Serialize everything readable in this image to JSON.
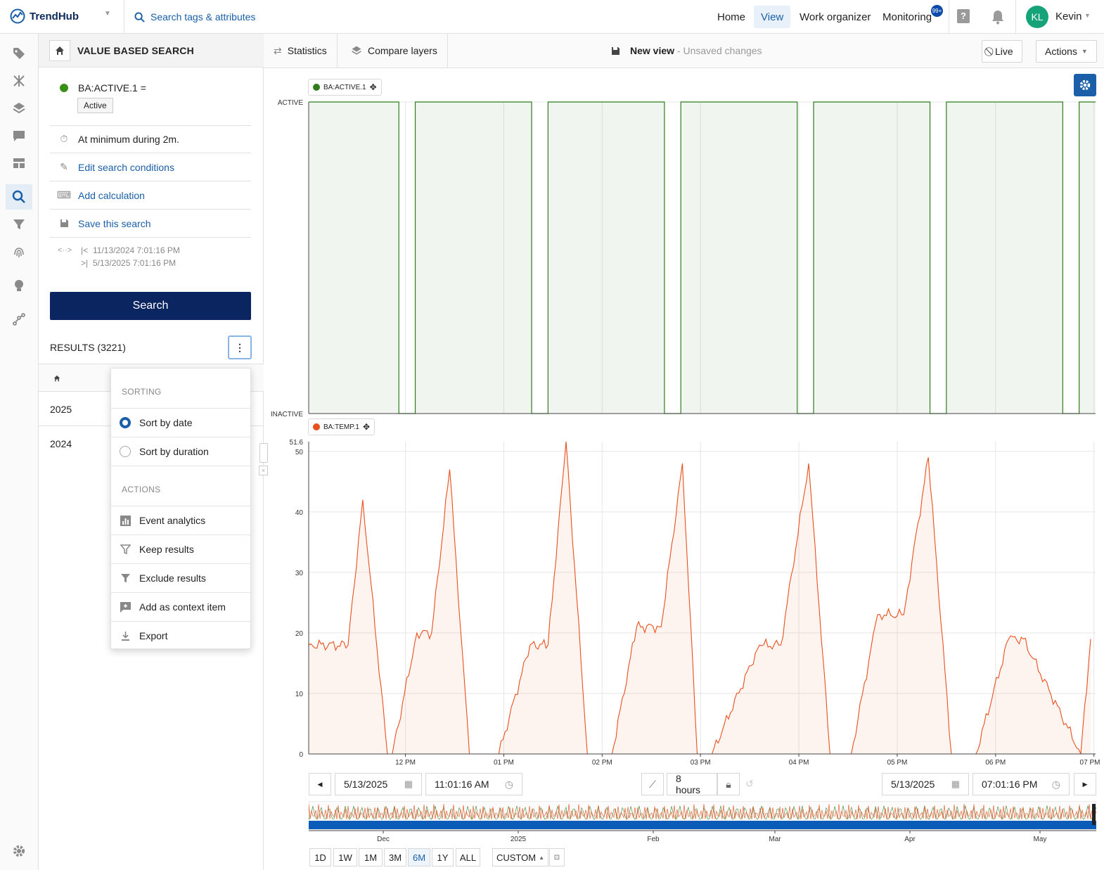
{
  "header": {
    "app_name": "TrendHub",
    "search_placeholder": "Search tags & attributes",
    "nav": [
      "Home",
      "View",
      "Work organizer",
      "Monitoring"
    ],
    "active_nav": "View",
    "monitoring_badge": "99+",
    "user_initials": "KL",
    "user_name": "Kevin"
  },
  "sidebar_icons": [
    "tag-icon",
    "network-icon",
    "layers-icon",
    "comment-icon",
    "dashboard-icon",
    "search-icon",
    "filter-icon",
    "fingerprint-icon",
    "lightbulb-icon",
    "graph-icon",
    "gear-icon"
  ],
  "panel": {
    "title": "VALUE BASED SEARCH",
    "tag": "BA:ACTIVE.1 =",
    "tag_value": "Active",
    "condition": "At minimum during 2m.",
    "edit_label": "Edit search conditions",
    "calc_label": "Add calculation",
    "save_label": "Save this search",
    "range_start": "11/13/2024 7:01:16 PM",
    "range_end": "5/13/2025 7:01:16 PM",
    "search_button": "Search",
    "results_label": "RESULTS (3221)",
    "years": [
      "2025",
      "2024"
    ]
  },
  "menu": {
    "sorting_label": "SORTING",
    "sort_by_date": "Sort by date",
    "sort_by_duration": "Sort by duration",
    "actions_label": "ACTIONS",
    "event_analytics": "Event analytics",
    "keep_results": "Keep results",
    "exclude_results": "Exclude results",
    "add_context": "Add as context item",
    "export": "Export"
  },
  "toolbar": {
    "statistics": "Statistics",
    "compare_layers": "Compare layers",
    "view_name": "New view",
    "view_status": " - Unsaved changes",
    "live": "Live",
    "actions": "Actions"
  },
  "time_controls": {
    "start_date": "5/13/2025",
    "start_time": "11:01:16 AM",
    "duration": "8 hours",
    "end_date": "5/13/2025",
    "end_time": "07:01:16 PM",
    "ranges": [
      "1D",
      "1W",
      "1M",
      "3M",
      "6M",
      "1Y",
      "ALL"
    ],
    "active_range": "6M",
    "custom": "CUSTOM",
    "overview_ticks": [
      "Dec",
      "2025",
      "Feb",
      "Mar",
      "Apr",
      "May"
    ]
  },
  "colors": {
    "active_series": "#2e7d1a",
    "temp_series": "#e8501e",
    "primary": "#0b2560",
    "link": "#1a5fa8"
  },
  "chart_data": [
    {
      "type": "line",
      "series": [
        {
          "name": "BA:ACTIVE.1",
          "color": "#2e7d1a"
        }
      ],
      "y_categories": [
        "INACTIVE",
        "ACTIVE"
      ],
      "x_tick_labels": [
        "12 PM",
        "01 PM",
        "02 PM",
        "03 PM",
        "04 PM",
        "05 PM",
        "06 PM",
        "07 PM"
      ],
      "x": [
        "11:01",
        "11:56",
        "12:06",
        "13:17",
        "13:27",
        "14:38",
        "14:48",
        "15:59",
        "16:09",
        "17:20",
        "17:30",
        "18:41",
        "18:51",
        "19:01"
      ],
      "values": [
        1,
        0,
        1,
        0,
        1,
        0,
        1,
        0,
        1,
        0,
        1,
        0,
        1,
        1
      ]
    },
    {
      "type": "area",
      "series": [
        {
          "name": "BA:TEMP.1",
          "color": "#e8501e"
        }
      ],
      "ylim": [
        0,
        51.6
      ],
      "y_ticks": [
        0,
        10,
        20,
        30,
        40,
        50
      ],
      "y_max_label": "51.6",
      "x_tick_labels": [
        "12 PM",
        "01 PM",
        "02 PM",
        "03 PM",
        "04 PM",
        "05 PM",
        "06 PM",
        "07 PM"
      ],
      "x": [
        "11:01",
        "11:25",
        "11:34",
        "11:49",
        "11:52",
        "12:07",
        "12:16",
        "12:27",
        "12:39",
        "12:56",
        "12:57",
        "13:16",
        "13:27",
        "13:38",
        "13:51",
        "14:06",
        "14:21",
        "14:36",
        "14:49",
        "14:58",
        "15:07",
        "15:36",
        "15:49",
        "16:06",
        "16:19",
        "16:32",
        "16:48",
        "17:04",
        "17:19",
        "17:33",
        "17:48",
        "18:08",
        "18:17",
        "18:52",
        "18:58"
      ],
      "values": [
        18,
        18,
        42,
        0,
        0,
        20,
        20,
        47,
        0,
        0,
        0,
        18,
        18,
        51.6,
        0,
        0,
        21,
        21,
        48,
        0,
        0,
        18,
        18,
        48,
        0,
        0,
        23,
        23,
        49,
        0,
        0,
        19,
        19,
        0,
        19
      ]
    }
  ]
}
